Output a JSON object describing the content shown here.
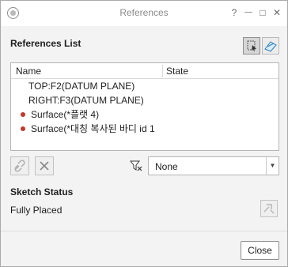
{
  "window": {
    "title": "References",
    "controls": {
      "help": "?",
      "minimize": "—",
      "maximize": "□",
      "close": "✕"
    }
  },
  "references_list": {
    "heading": "References List",
    "columns": [
      "Name",
      "State"
    ],
    "rows": [
      {
        "name": "TOP:F2(DATUM PLANE)",
        "state": "",
        "marker": false
      },
      {
        "name": "RIGHT:F3(DATUM PLANE)",
        "state": "",
        "marker": false
      },
      {
        "name": "Surface(*플랫 4)",
        "state": "",
        "marker": true
      },
      {
        "name": "Surface(*대칭 복사된 바디 id 1",
        "state": "",
        "marker": true
      }
    ],
    "marker_color": "#c0392b"
  },
  "filter": {
    "icon": "filter-icon",
    "selected": "None"
  },
  "sketch_status": {
    "heading": "Sketch Status",
    "value": "Fully Placed"
  },
  "footer": {
    "close_label": "Close"
  }
}
